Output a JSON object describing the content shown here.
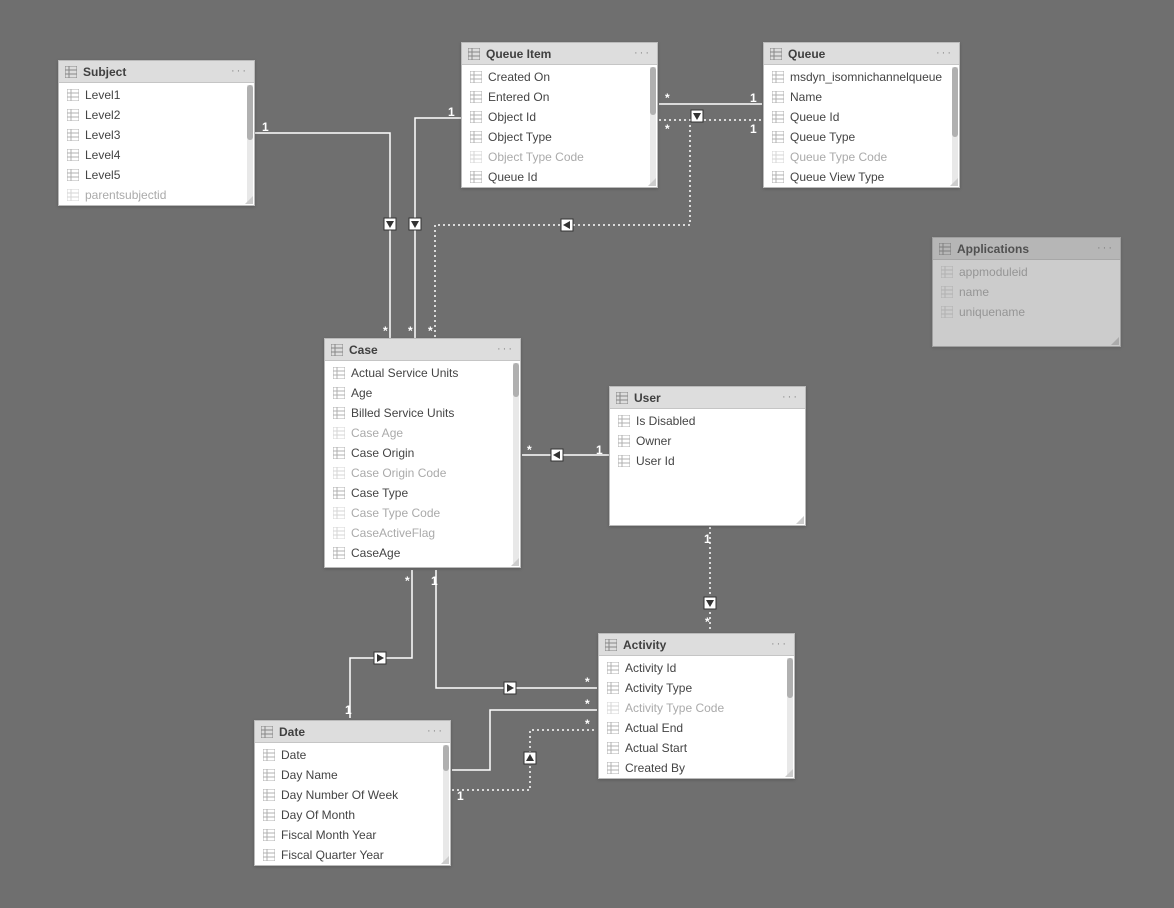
{
  "entities": {
    "subject": {
      "title": "Subject",
      "fields": [
        {
          "label": "Level1",
          "dim": false
        },
        {
          "label": "Level2",
          "dim": false
        },
        {
          "label": "Level3",
          "dim": false
        },
        {
          "label": "Level4",
          "dim": false
        },
        {
          "label": "Level5",
          "dim": false
        },
        {
          "label": "parentsubjectid",
          "dim": true
        }
      ]
    },
    "queueItem": {
      "title": "Queue Item",
      "fields": [
        {
          "label": "Created On",
          "dim": false
        },
        {
          "label": "Entered On",
          "dim": false
        },
        {
          "label": "Object Id",
          "dim": false
        },
        {
          "label": "Object Type",
          "dim": false
        },
        {
          "label": "Object Type Code",
          "dim": true
        },
        {
          "label": "Queue Id",
          "dim": false
        }
      ]
    },
    "queue": {
      "title": "Queue",
      "fields": [
        {
          "label": "msdyn_isomnichannelqueue",
          "dim": false
        },
        {
          "label": "Name",
          "dim": false
        },
        {
          "label": "Queue Id",
          "dim": false
        },
        {
          "label": "Queue Type",
          "dim": false
        },
        {
          "label": "Queue Type Code",
          "dim": true
        },
        {
          "label": "Queue View Type",
          "dim": false
        }
      ]
    },
    "applications": {
      "title": "Applications",
      "fields": [
        {
          "label": "appmoduleid",
          "dim": false
        },
        {
          "label": "name",
          "dim": false
        },
        {
          "label": "uniquename",
          "dim": false
        }
      ]
    },
    "case": {
      "title": "Case",
      "fields": [
        {
          "label": "Actual Service Units",
          "dim": false
        },
        {
          "label": "Age",
          "dim": false
        },
        {
          "label": "Billed Service Units",
          "dim": false
        },
        {
          "label": "Case Age",
          "dim": true
        },
        {
          "label": "Case Origin",
          "dim": false
        },
        {
          "label": "Case Origin Code",
          "dim": true
        },
        {
          "label": "Case Type",
          "dim": false
        },
        {
          "label": "Case Type Code",
          "dim": true
        },
        {
          "label": "CaseActiveFlag",
          "dim": true
        },
        {
          "label": "CaseAge",
          "dim": false
        }
      ]
    },
    "user": {
      "title": "User",
      "fields": [
        {
          "label": "Is Disabled",
          "dim": false
        },
        {
          "label": "Owner",
          "dim": false
        },
        {
          "label": "User Id",
          "dim": false
        }
      ]
    },
    "activity": {
      "title": "Activity",
      "fields": [
        {
          "label": "Activity Id",
          "dim": false
        },
        {
          "label": "Activity Type",
          "dim": false
        },
        {
          "label": "Activity Type Code",
          "dim": true
        },
        {
          "label": "Actual End",
          "dim": false
        },
        {
          "label": "Actual Start",
          "dim": false
        },
        {
          "label": "Created By",
          "dim": false
        }
      ]
    },
    "date": {
      "title": "Date",
      "fields": [
        {
          "label": "Date",
          "dim": false
        },
        {
          "label": "Day Name",
          "dim": false
        },
        {
          "label": "Day Number Of Week",
          "dim": false
        },
        {
          "label": "Day Of Month",
          "dim": false
        },
        {
          "label": "Fiscal Month Year",
          "dim": false
        },
        {
          "label": "Fiscal Quarter Year",
          "dim": false
        }
      ]
    }
  },
  "cardinality": {
    "one": "1",
    "many": "*"
  },
  "more_label": "···"
}
